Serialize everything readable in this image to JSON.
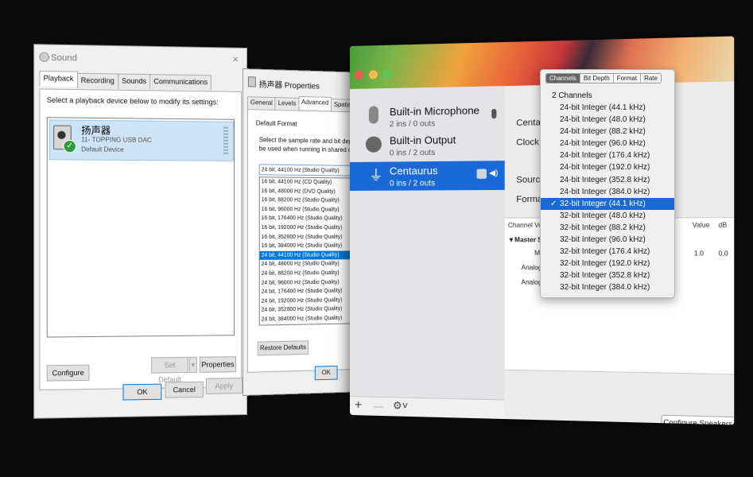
{
  "sound": {
    "title": "Sound",
    "close": "×",
    "tabs": [
      "Playback",
      "Recording",
      "Sounds",
      "Communications"
    ],
    "instruction": "Select a playback device below to modify its settings:",
    "device": {
      "name": "扬声器",
      "subtitle": "11- TOPPING USB DAC",
      "status": "Default Device"
    },
    "buttons": {
      "configure": "Configure",
      "set_default": "Set Default",
      "dropdown": "▾",
      "properties": "Properties",
      "ok": "OK",
      "cancel": "Cancel",
      "apply": "Apply"
    }
  },
  "props": {
    "title": "扬声器 Properties",
    "tabs": [
      "General",
      "Levels",
      "Advanced",
      "Spatial sound"
    ],
    "group": "Default Format",
    "description": "Select the sample rate and bit depth to be used when running in shared mode.",
    "selected": "24 bit, 44100 Hz (Studio Quality)",
    "options": [
      "16 bit, 44100 Hz (CD Quality)",
      "16 bit, 48000 Hz (DVD Quality)",
      "16 bit, 88200 Hz (Studio Quality)",
      "16 bit, 96000 Hz (Studio Quality)",
      "16 bit, 176400 Hz (Studio Quality)",
      "16 bit, 192000 Hz (Studio Quality)",
      "16 bit, 352800 Hz (Studio Quality)",
      "16 bit, 384000 Hz (Studio Quality)",
      "24 bit, 44100 Hz (Studio Quality)",
      "24 bit, 48000 Hz (Studio Quality)",
      "24 bit, 88200 Hz (Studio Quality)",
      "24 bit, 96000 Hz (Studio Quality)",
      "24 bit, 176400 Hz (Studio Quality)",
      "24 bit, 192000 Hz (Studio Quality)",
      "24 bit, 352800 Hz (Studio Quality)",
      "24 bit, 384000 Hz (Studio Quality)"
    ],
    "selected_index": 8,
    "restore": "Restore Defaults",
    "ok": "OK"
  },
  "mac": {
    "devices": [
      {
        "name": "Built-in Microphone",
        "sub": "2 ins / 0 outs"
      },
      {
        "name": "Built-in Output",
        "sub": "0 ins / 2 outs"
      },
      {
        "name": "Centaurus",
        "sub": "0 ins / 2 outs"
      }
    ],
    "selected_device": 2,
    "labels": {
      "device": "Centau",
      "clock": "Clock S",
      "source": "Source",
      "format": "Format",
      "channel_vol": "Channel Vo",
      "value": "Value",
      "db": "dB",
      "master": "▼Master S",
      "mas": "Mas",
      "val": "1.0",
      "dbval": "0.0",
      "analog1": "Analogu",
      "analog2": "Analogu"
    },
    "configure_speakers": "Configure Speakers...",
    "bottom": {
      "add": "+",
      "remove": "—",
      "gear": "⚙︎˅"
    },
    "popup": {
      "segments": [
        "Channels",
        "Bit Depth",
        "Format",
        "Rate"
      ],
      "header": "2 Channels",
      "items": [
        "24-bit Integer (44.1 kHz)",
        "24-bit Integer (48.0 kHz)",
        "24-bit Integer (88.2 kHz)",
        "24-bit Integer (96.0 kHz)",
        "24-bit Integer (176.4 kHz)",
        "24-bit Integer (192.0 kHz)",
        "24-bit Integer (352.8 kHz)",
        "24-bit Integer (384.0 kHz)",
        "32-bit Integer (44.1 kHz)",
        "32-bit Integer (48.0 kHz)",
        "32-bit Integer (88.2 kHz)",
        "32-bit Integer (96.0 kHz)",
        "32-bit Integer (176.4 kHz)",
        "32-bit Integer (192.0 kHz)",
        "32-bit Integer (352.8 kHz)",
        "32-bit Integer (384.0 kHz)"
      ],
      "selected_index": 8,
      "check": "✓"
    }
  },
  "colors": {
    "win_select": "#0078d7",
    "mac_select": "#1a69d6",
    "mac_close": "#ee5a52",
    "mac_min": "#f5bd4f",
    "mac_max": "#5fc454",
    "default_check": "#2d9b3e"
  }
}
